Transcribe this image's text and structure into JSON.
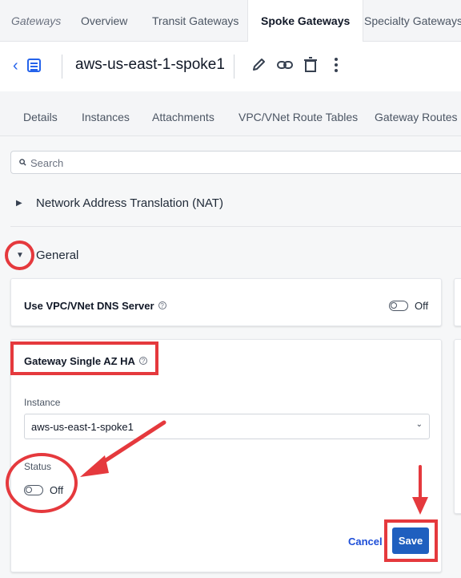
{
  "top_tabs": [
    "Gateways",
    "Overview",
    "Transit Gateways",
    "Spoke Gateways",
    "Specialty Gateways"
  ],
  "header": {
    "title": "aws-us-east-1-spoke1"
  },
  "sub_tabs": [
    "Details",
    "Instances",
    "Attachments",
    "VPC/VNet Route Tables",
    "Gateway Routes"
  ],
  "search": {
    "placeholder": "Search"
  },
  "sections": {
    "nat": "Network Address Translation (NAT)",
    "general": "General"
  },
  "dns_card": {
    "title": "Use VPC/VNet DNS Server",
    "toggle_state": "Off"
  },
  "ha_card": {
    "title": "Gateway Single AZ HA",
    "instance_label": "Instance",
    "instance_value": "aws-us-east-1-spoke1",
    "status_label": "Status",
    "status_value": "Off"
  },
  "actions": {
    "cancel": "Cancel",
    "save": "Save"
  },
  "colors": {
    "accent": "#2563eb",
    "save_button": "#1f5fbf",
    "annotation": "#e5393d"
  }
}
